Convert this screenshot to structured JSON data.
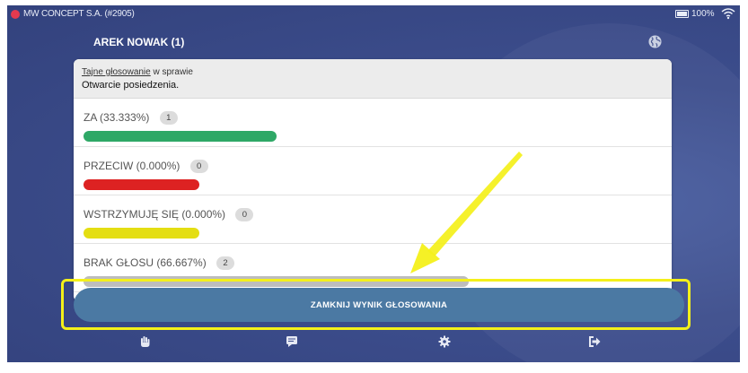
{
  "status_bar": {
    "title": "MW CONCEPT S.A. (#2905)",
    "battery": "100%",
    "icons": [
      "status-dot-icon",
      "battery-icon",
      "wifi-icon"
    ]
  },
  "header": {
    "user_name": "AREK NOWAK (1)",
    "globe_icon": "globe-icon"
  },
  "vote": {
    "secret_label": "Tajne głosowanie",
    "in_matter_label": " w sprawie",
    "subject": "Otwarcie posiedzenia."
  },
  "options": [
    {
      "label": "ZA (33.333%)",
      "count": "1",
      "percent": 33.333,
      "color": "#2ea866"
    },
    {
      "label": "PRZECIW (0.000%)",
      "count": "0",
      "percent": 0.0,
      "color": "#dd2222"
    },
    {
      "label": "WSTRZYMUJĘ SIĘ (0.000%)",
      "count": "0",
      "percent": 0.0,
      "color": "#e4de12"
    },
    {
      "label": "BRAK GŁOSU (66.667%)",
      "count": "2",
      "percent": 66.667,
      "color": "#bdbdbd"
    }
  ],
  "close_button": {
    "label": "ZAMKNIJ WYNIK GŁOSOWANIA"
  },
  "bottom_nav": [
    "hand-icon",
    "message-icon",
    "gear-icon",
    "logout-icon"
  ],
  "colors": {
    "background": "#3c4d8c",
    "button": "#4b79a3",
    "highlight": "#f4f01a"
  }
}
